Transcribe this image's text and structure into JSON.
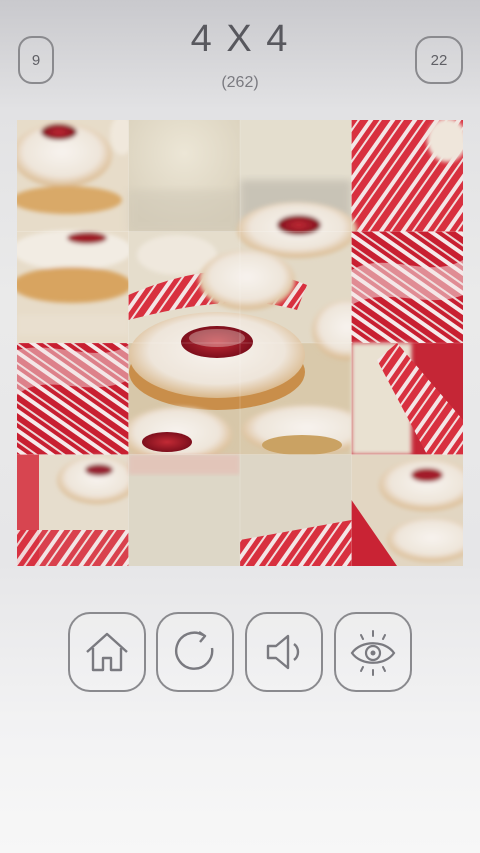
{
  "header": {
    "title": "4 X 4",
    "subtitle": "(262)",
    "left_counter": "9",
    "right_counter": "22"
  },
  "puzzle": {
    "grid": "4x4",
    "image": "jam-filled sugar cookies with red striped ribbon"
  },
  "controls": [
    {
      "name": "home-button",
      "icon": "home-icon"
    },
    {
      "name": "restart-button",
      "icon": "restart-icon"
    },
    {
      "name": "sound-button",
      "icon": "speaker-icon"
    },
    {
      "name": "preview-button",
      "icon": "eye-icon"
    }
  ],
  "colors": {
    "frame": "#8a8a8e",
    "text": "#58585e",
    "cookie": "#e3c089",
    "sugar": "#f4efe8",
    "jam": "#a8192a",
    "ribbon_red": "#d42a3a",
    "background_cream": "#e6e0cf"
  }
}
